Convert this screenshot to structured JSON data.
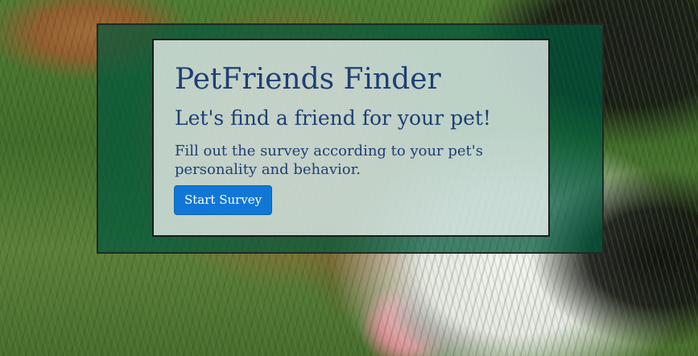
{
  "hero": {
    "title": "PetFriends Finder",
    "subtitle": "Let's find a friend for your pet!",
    "description": "Fill out the survey according to your pet's personality and behavior.",
    "cta_label": "Start Survey"
  },
  "colors": {
    "overlay_green": "#00583c",
    "title_blue": "#1d3f73",
    "button_blue": "#1177d6"
  }
}
